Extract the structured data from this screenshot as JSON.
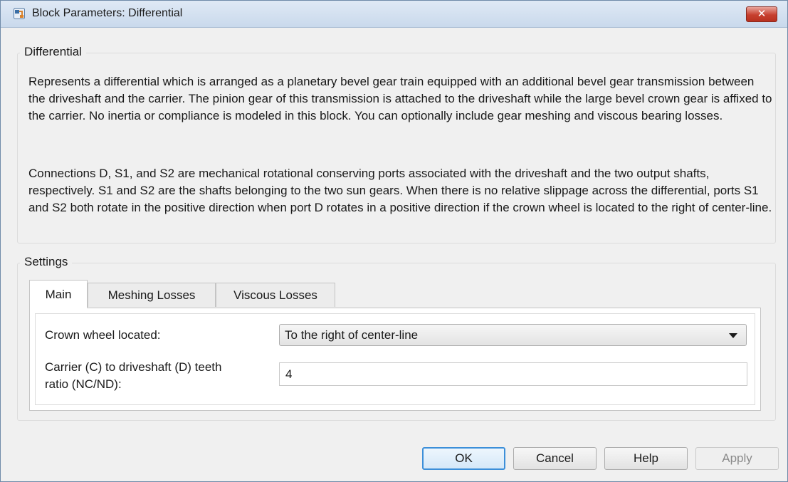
{
  "window": {
    "title": "Block Parameters: Differential",
    "close_label": "✕",
    "icon": "simulink-block-icon"
  },
  "description": {
    "legend": "Differential",
    "paragraph1": "Represents a differential which is arranged as a planetary bevel gear train equipped with an additional bevel gear transmission between the driveshaft and the carrier. The pinion gear of this transmission is attached to the driveshaft while the large bevel crown gear is affixed to the carrier. No inertia or compliance is modeled in this block. You can optionally include gear meshing and viscous bearing losses.",
    "paragraph2": "Connections D, S1, and S2 are mechanical rotational conserving ports associated with the driveshaft and the two output shafts, respectively. S1 and S2 are the shafts belonging to the two sun gears. When there is no relative slippage across the differential, ports S1 and S2 both rotate in the positive direction when port D rotates in a positive direction if the crown wheel is located to the right of center-line."
  },
  "settings": {
    "legend": "Settings",
    "tabs": [
      {
        "label": "Main",
        "active": true
      },
      {
        "label": "Meshing Losses",
        "active": false
      },
      {
        "label": "Viscous Losses",
        "active": false
      }
    ],
    "crown_wheel": {
      "label": "Crown wheel located:",
      "value": "To the right of center-line"
    },
    "teeth_ratio": {
      "label_line1": "Carrier (C) to driveshaft (D) teeth",
      "label_line2": "ratio (NC/ND):",
      "value": "4"
    }
  },
  "buttons": {
    "ok": "OK",
    "cancel": "Cancel",
    "help": "Help",
    "apply": "Apply"
  },
  "colors": {
    "accent": "#3c8fd9",
    "close": "#c7402f"
  }
}
